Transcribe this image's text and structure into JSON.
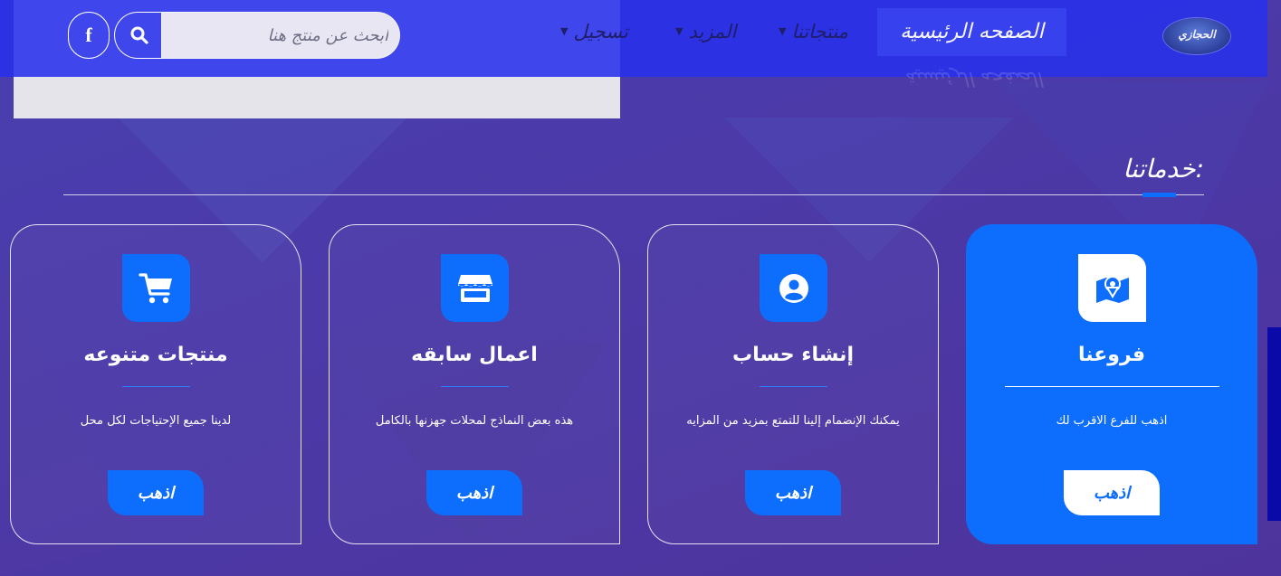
{
  "navbar": {
    "logo_text": "الحجازي",
    "home": "الصفحه الرئيسية",
    "products": "منتجاتنا",
    "more": "المزيد",
    "register": "تسجيل",
    "search_placeholder": "ابحث عن منتج هنا",
    "facebook": "f"
  },
  "services": {
    "title": "خدماتنا:",
    "cards": [
      {
        "title": "فروعنا",
        "desc": "اذهب للفرع الاقرب لك",
        "button": "اذهب",
        "icon": "map-pin-icon"
      },
      {
        "title": "إنشاء حساب",
        "desc": "يمكنك الإنضمام إلينا للتمتع بمزيد من المزايه",
        "button": "اذهب",
        "icon": "user-circle-icon"
      },
      {
        "title": "اعمال سابقه",
        "desc": "هذه بعض النماذج لمحلات جهزنها بالكامل",
        "button": "اذهب",
        "icon": "store-icon"
      },
      {
        "title": "منتجات متنوعه",
        "desc": "لدينا جميع الإحتياجات لكل محل",
        "button": "اذهب",
        "icon": "cart-icon"
      }
    ]
  },
  "colors": {
    "accent": "#0d6efd",
    "navbar": "#2830eb",
    "background": "#4b3aa8"
  }
}
